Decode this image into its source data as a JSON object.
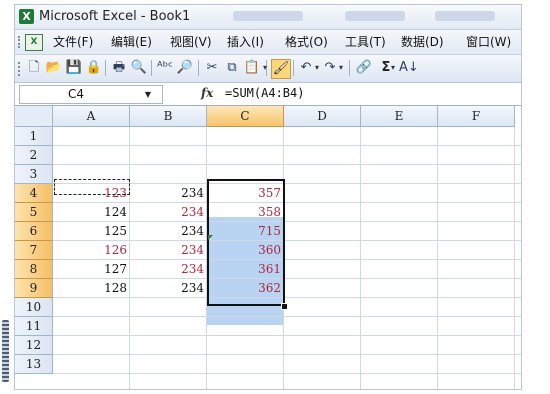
{
  "window": {
    "title": "Microsoft Excel - Book1",
    "app_icon": "excel-icon"
  },
  "menu": {
    "doc_icon": "workbook-icon",
    "items": [
      "文件(F)",
      "编辑(E)",
      "视图(V)",
      "插入(I)",
      "格式(O)",
      "工具(T)",
      "数据(D)",
      "窗口(W)"
    ]
  },
  "toolbar": {
    "buttons": [
      {
        "icon": "new-icon",
        "glyph": "🗋"
      },
      {
        "icon": "open-icon",
        "glyph": "📂"
      },
      {
        "icon": "save-icon",
        "glyph": "💾"
      },
      {
        "icon": "permission-icon",
        "glyph": "🔒"
      },
      {
        "icon": "print-icon",
        "glyph": "🖶"
      },
      {
        "icon": "print-preview-icon",
        "glyph": "🔍"
      },
      {
        "icon": "spelling-icon",
        "glyph": "ᴬᵇᶜ"
      },
      {
        "icon": "research-icon",
        "glyph": "🔎"
      },
      {
        "icon": "cut-icon",
        "glyph": "✂"
      },
      {
        "icon": "copy-icon",
        "glyph": "⧉"
      },
      {
        "icon": "paste-icon",
        "glyph": "📋"
      },
      {
        "icon": "format-painter-icon",
        "glyph": "🖌"
      },
      {
        "icon": "undo-icon",
        "glyph": "↶"
      },
      {
        "icon": "redo-icon",
        "glyph": "↷"
      },
      {
        "icon": "hyperlink-icon",
        "glyph": "🔗"
      },
      {
        "icon": "autosum-icon",
        "glyph": "Σ"
      },
      {
        "icon": "sort-ascending-icon",
        "glyph": "A↓"
      }
    ]
  },
  "formula_bar": {
    "name_box": "C4",
    "fx_label": "fx",
    "formula": "=SUM(A4:B4)"
  },
  "sheet": {
    "columns": [
      "A",
      "B",
      "C",
      "D",
      "E",
      "F"
    ],
    "selected_column": "C",
    "rows": [
      "1",
      "2",
      "3",
      "4",
      "5",
      "6",
      "7",
      "8",
      "9",
      "10",
      "11",
      "12",
      "13"
    ],
    "selected_rows": [
      "4",
      "5",
      "6",
      "7",
      "8",
      "9"
    ],
    "active_cell": "C4",
    "selection": "C4:C9",
    "copy_range": "A4:B4",
    "cells": [
      {
        "ref": "A4",
        "value": "123",
        "red": true
      },
      {
        "ref": "B4",
        "value": "234",
        "red": false
      },
      {
        "ref": "C4",
        "value": "357",
        "red": true
      },
      {
        "ref": "A5",
        "value": "124",
        "red": false
      },
      {
        "ref": "B5",
        "value": "234",
        "red": true
      },
      {
        "ref": "C5",
        "value": "358",
        "red": true
      },
      {
        "ref": "A6",
        "value": "125",
        "red": false
      },
      {
        "ref": "B6",
        "value": "234",
        "red": false
      },
      {
        "ref": "C6",
        "value": "715",
        "red": true
      },
      {
        "ref": "A7",
        "value": "126",
        "red": true
      },
      {
        "ref": "B7",
        "value": "234",
        "red": true
      },
      {
        "ref": "C7",
        "value": "360",
        "red": true
      },
      {
        "ref": "A8",
        "value": "127",
        "red": false
      },
      {
        "ref": "B8",
        "value": "234",
        "red": true
      },
      {
        "ref": "C8",
        "value": "361",
        "red": true
      },
      {
        "ref": "A9",
        "value": "128",
        "red": false
      },
      {
        "ref": "B9",
        "value": "234",
        "red": false
      },
      {
        "ref": "C9",
        "value": "362",
        "red": true
      }
    ]
  }
}
